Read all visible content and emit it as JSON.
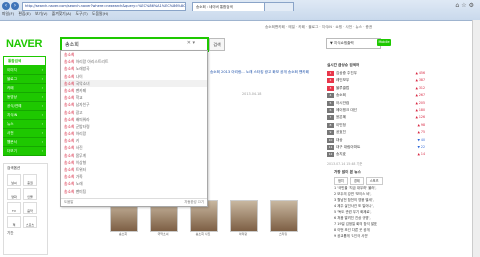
{
  "browser": {
    "address": "http://search.naver.com/search.naver?where=nexearch&query=%EC%86%A1%EC%86%8C%ED%9D%AC",
    "tab_active": "송소희 : 네이버 통합검색",
    "tab_inactive": "",
    "menu": [
      "파일(F)",
      "편집(E)",
      "보기(V)",
      "즐겨찾기(A)",
      "도구(T)",
      "도움말(H)"
    ]
  },
  "header": {
    "logo": "NAVER",
    "topnav": "송소희팬카페 · 메일 · 카페 · 블로그 · 지식iN · 쇼핑 · 사전 · 뉴스 · 증권",
    "search_value": "송소희",
    "search_button": "검색",
    "mobile_box": "▼ 지식쇼핑출력",
    "mobile_badge": "Mobile"
  },
  "sidebar": {
    "items": [
      {
        "label": "통합검색",
        "arrow": ""
      },
      {
        "label": "이미지",
        "arrow": "›"
      },
      {
        "label": "블로그",
        "arrow": "›"
      },
      {
        "label": "카페",
        "arrow": "›"
      },
      {
        "label": "동영상",
        "arrow": "›"
      },
      {
        "label": "공식/연예",
        "arrow": "›"
      },
      {
        "label": "지식iN",
        "arrow": "›"
      },
      {
        "label": "뉴스",
        "arrow": "›"
      },
      {
        "label": "사전",
        "arrow": "›"
      },
      {
        "label": "웹문서",
        "arrow": "›"
      },
      {
        "label": "더보기",
        "arrow": "›"
      }
    ],
    "panel_title": "검색옵션",
    "panel_cells": [
      "날씨",
      "증권",
      "영화",
      "인물",
      "TV",
      "음악",
      "책",
      "스포츠"
    ],
    "panel_foot": "기간"
  },
  "dropdown": {
    "suggestions": [
      {
        "q": "송소희",
        "rest": ""
      },
      {
        "q": "송소희",
        "rest": " 아리랑 아리스트리트"
      },
      {
        "q": "송소희",
        "rest": " 노래방곡"
      },
      {
        "q": "송소희",
        "rest": " 나이"
      },
      {
        "q": "송소희",
        "rest": " 국악소녀"
      },
      {
        "q": "송소희",
        "rest": " 팬카페"
      },
      {
        "q": "송소희",
        "rest": " 학교"
      },
      {
        "q": "송소희",
        "rest": " 남자친구"
      },
      {
        "q": "송소희",
        "rest": " 광고"
      },
      {
        "q": "송소희",
        "rest": " 배띄워라"
      },
      {
        "q": "송소희",
        "rest": " 군밤타령"
      },
      {
        "q": "송소희",
        "rest": " 아리랑"
      },
      {
        "q": "송소희",
        "rest": " 키"
      },
      {
        "q": "송소희",
        "rest": " 사진"
      },
      {
        "q": "송소희",
        "rest": " 몸무게"
      },
      {
        "q": "송소희",
        "rest": " 이상형"
      },
      {
        "q": "송소희",
        "rest": " 트위터"
      },
      {
        "q": "송소희",
        "rest": " 가족"
      },
      {
        "q": "송소희",
        "rest": " 노래"
      },
      {
        "q": "송소희",
        "rest": " 팬미팅"
      }
    ],
    "foot_left": "도움말",
    "foot_right": "자동완성 끄기"
  },
  "main": {
    "title": "송소희",
    "news_row": "송소희 2013 아리랑... 노래 스타킹  광고 화보 공개  송소희 팬카페",
    "date": "2013.04.18",
    "profile": [
      "송소희  가수",
      "출생  1997년",
      "소속  한국국악협회"
    ],
    "image_section": "이미지",
    "thumb_caps": [
      "송소희",
      "국악소녀",
      "송소희 사진",
      "아리랑",
      "스타킹"
    ]
  },
  "realtime": {
    "title": "실시간 급상승 검색어",
    "rows": [
      {
        "rank": "1",
        "term": "김상중 주진우",
        "delta": "▲ 456"
      },
      {
        "rank": "2",
        "term": "레인보우",
        "delta": "▲ 387"
      },
      {
        "rank": "3",
        "term": "블루클럽",
        "delta": "▲ 312"
      },
      {
        "rank": "4",
        "term": "송소희",
        "delta": "▲ 267"
      },
      {
        "rank": "5",
        "term": "아시안컵",
        "delta": "▲ 205"
      },
      {
        "rank": "6",
        "term": "에이핑크 대선",
        "delta": "▲ 180"
      },
      {
        "rank": "7",
        "term": "윤은혜",
        "delta": "▲ 126"
      },
      {
        "rank": "8",
        "term": "이민정",
        "delta": "▲ 98"
      },
      {
        "rank": "9",
        "term": "공효진",
        "delta": "▲ 75"
      },
      {
        "rank": "10",
        "term": "대상",
        "delta": "▼ 40"
      },
      {
        "rank": "11",
        "term": "대구 대림아파트",
        "delta": "▼ 22"
      },
      {
        "rank": "12",
        "term": "송지효",
        "delta": "▲ 14"
      }
    ],
    "updated": "2013.07.14 15:48 기준"
  },
  "box2": {
    "title": "가장 많이 본 뉴스",
    "tabs": [
      "정치",
      "경제",
      "스포츠"
    ],
    "items": [
      "1 '국민을 '지금 대우하' 불러',",
      "2 모두의 강연 '보이스 비',",
      "3 월남전 참전의 영웅 별세',",
      "4 제주 살인사건 또 일어나',",
      "5 '독도 관련 무기 화제로',",
      "6 처음 알려진 진상 규명',",
      "7 19일 김정일 회의 참석 발표",
      "8 이번 조선 다른 곳 공개",
      "9 공교롭게 '1인극 사건'"
    ]
  }
}
